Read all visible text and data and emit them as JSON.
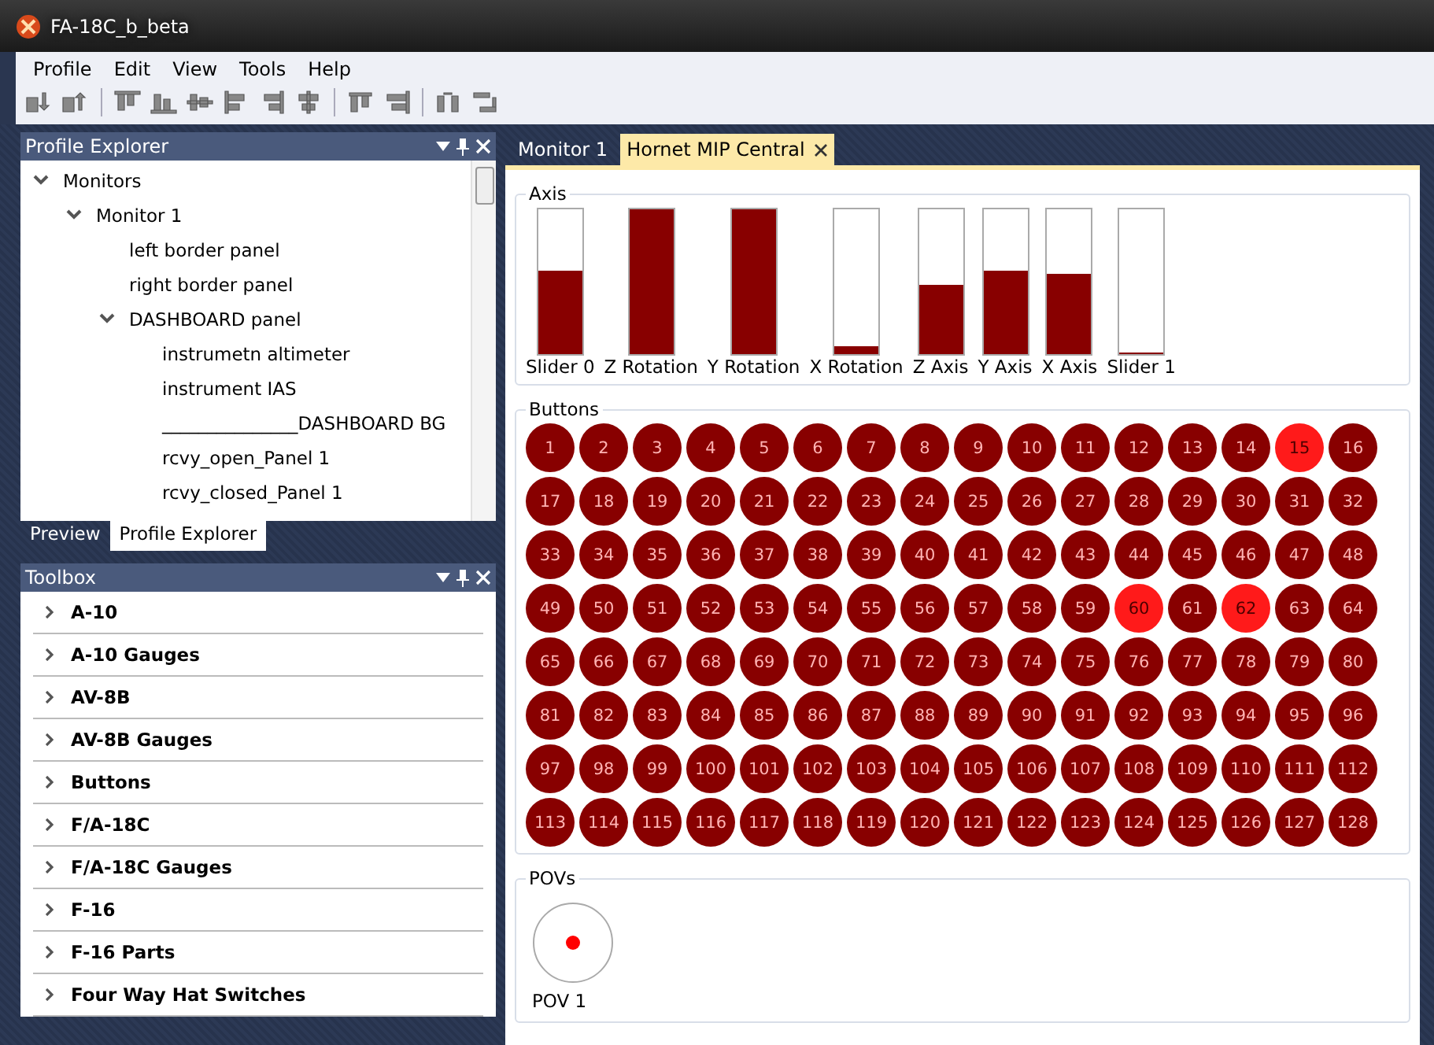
{
  "window": {
    "title": "FA-18C_b_beta"
  },
  "menu": [
    "Profile",
    "Edit",
    "View",
    "Tools",
    "Help"
  ],
  "profile_explorer": {
    "title": "Profile Explorer",
    "tree": [
      {
        "label": "Monitors",
        "expanded": true,
        "children": [
          {
            "label": "Monitor 1",
            "expanded": true,
            "children": [
              {
                "label": "left border panel"
              },
              {
                "label": "right border panel"
              },
              {
                "label": "DASHBOARD panel",
                "expanded": true,
                "children": [
                  {
                    "label": "instrumetn altimeter"
                  },
                  {
                    "label": "instrument IAS"
                  },
                  {
                    "label": "_______________DASHBOARD BG"
                  },
                  {
                    "label": "rcvy_open_Panel 1"
                  },
                  {
                    "label": "rcvy_closed_Panel 1"
                  }
                ]
              }
            ]
          }
        ]
      }
    ],
    "tabs": [
      {
        "label": "Preview",
        "selected": false
      },
      {
        "label": "Profile Explorer",
        "selected": true
      }
    ]
  },
  "toolbox": {
    "title": "Toolbox",
    "items": [
      "A-10",
      "A-10 Gauges",
      "AV-8B",
      "AV-8B Gauges",
      "Buttons",
      "F/A-18C",
      "F/A-18C Gauges",
      "F-16",
      "F-16 Parts",
      "Four Way Hat Switches"
    ]
  },
  "document_tabs": [
    {
      "label": "Monitor 1",
      "selected": false
    },
    {
      "label": "Hornet MIP Central",
      "selected": true,
      "closable": true
    }
  ],
  "axis": {
    "title": "Axis",
    "items": [
      {
        "name": "Slider 0",
        "level": 0.58
      },
      {
        "name": "Z Rotation",
        "level": 1
      },
      {
        "name": "Y Rotation",
        "level": 1
      },
      {
        "name": "X Rotation",
        "level": 0.05
      },
      {
        "name": "Z Axis",
        "level": 0.48
      },
      {
        "name": "Y Axis",
        "level": 0.58
      },
      {
        "name": "X Axis",
        "level": 0.55
      },
      {
        "name": "Slider 1",
        "level": 0
      }
    ]
  },
  "buttons": {
    "title": "Buttons",
    "items": [
      {
        "label": "1",
        "pressed": false
      },
      {
        "label": "2",
        "pressed": false
      },
      {
        "label": "3",
        "pressed": false
      },
      {
        "label": "4",
        "pressed": false
      },
      {
        "label": "5",
        "pressed": false
      },
      {
        "label": "6",
        "pressed": false
      },
      {
        "label": "7",
        "pressed": false
      },
      {
        "label": "8",
        "pressed": false
      },
      {
        "label": "9",
        "pressed": false
      },
      {
        "label": "10",
        "pressed": false
      },
      {
        "label": "11",
        "pressed": false
      },
      {
        "label": "12",
        "pressed": false
      },
      {
        "label": "13",
        "pressed": false
      },
      {
        "label": "14",
        "pressed": false
      },
      {
        "label": "15",
        "pressed": true
      },
      {
        "label": "16",
        "pressed": false
      },
      {
        "label": "17",
        "pressed": false
      },
      {
        "label": "18",
        "pressed": false
      },
      {
        "label": "19",
        "pressed": false
      },
      {
        "label": "20",
        "pressed": false
      },
      {
        "label": "21",
        "pressed": false
      },
      {
        "label": "22",
        "pressed": false
      },
      {
        "label": "23",
        "pressed": false
      },
      {
        "label": "24",
        "pressed": false
      },
      {
        "label": "25",
        "pressed": false
      },
      {
        "label": "26",
        "pressed": false
      },
      {
        "label": "27",
        "pressed": false
      },
      {
        "label": "28",
        "pressed": false
      },
      {
        "label": "29",
        "pressed": false
      },
      {
        "label": "30",
        "pressed": false
      },
      {
        "label": "31",
        "pressed": false
      },
      {
        "label": "32",
        "pressed": false
      },
      {
        "label": "33",
        "pressed": false
      },
      {
        "label": "34",
        "pressed": false
      },
      {
        "label": "35",
        "pressed": false
      },
      {
        "label": "36",
        "pressed": false
      },
      {
        "label": "37",
        "pressed": false
      },
      {
        "label": "38",
        "pressed": false
      },
      {
        "label": "39",
        "pressed": false
      },
      {
        "label": "40",
        "pressed": false
      },
      {
        "label": "41",
        "pressed": false
      },
      {
        "label": "42",
        "pressed": false
      },
      {
        "label": "43",
        "pressed": false
      },
      {
        "label": "44",
        "pressed": false
      },
      {
        "label": "45",
        "pressed": false
      },
      {
        "label": "46",
        "pressed": false
      },
      {
        "label": "47",
        "pressed": false
      },
      {
        "label": "48",
        "pressed": false
      },
      {
        "label": "49",
        "pressed": false
      },
      {
        "label": "50",
        "pressed": false
      },
      {
        "label": "51",
        "pressed": false
      },
      {
        "label": "52",
        "pressed": false
      },
      {
        "label": "53",
        "pressed": false
      },
      {
        "label": "54",
        "pressed": false
      },
      {
        "label": "55",
        "pressed": false
      },
      {
        "label": "56",
        "pressed": false
      },
      {
        "label": "57",
        "pressed": false
      },
      {
        "label": "58",
        "pressed": false
      },
      {
        "label": "59",
        "pressed": false
      },
      {
        "label": "60",
        "pressed": true
      },
      {
        "label": "61",
        "pressed": false
      },
      {
        "label": "62",
        "pressed": true
      },
      {
        "label": "63",
        "pressed": false
      },
      {
        "label": "64",
        "pressed": false
      },
      {
        "label": "65",
        "pressed": false
      },
      {
        "label": "66",
        "pressed": false
      },
      {
        "label": "67",
        "pressed": false
      },
      {
        "label": "68",
        "pressed": false
      },
      {
        "label": "69",
        "pressed": false
      },
      {
        "label": "70",
        "pressed": false
      },
      {
        "label": "71",
        "pressed": false
      },
      {
        "label": "72",
        "pressed": false
      },
      {
        "label": "73",
        "pressed": false
      },
      {
        "label": "74",
        "pressed": false
      },
      {
        "label": "75",
        "pressed": false
      },
      {
        "label": "76",
        "pressed": false
      },
      {
        "label": "77",
        "pressed": false
      },
      {
        "label": "78",
        "pressed": false
      },
      {
        "label": "79",
        "pressed": false
      },
      {
        "label": "80",
        "pressed": false
      },
      {
        "label": "81",
        "pressed": false
      },
      {
        "label": "82",
        "pressed": false
      },
      {
        "label": "83",
        "pressed": false
      },
      {
        "label": "84",
        "pressed": false
      },
      {
        "label": "85",
        "pressed": false
      },
      {
        "label": "86",
        "pressed": false
      },
      {
        "label": "87",
        "pressed": false
      },
      {
        "label": "88",
        "pressed": false
      },
      {
        "label": "89",
        "pressed": false
      },
      {
        "label": "90",
        "pressed": false
      },
      {
        "label": "91",
        "pressed": false
      },
      {
        "label": "92",
        "pressed": false
      },
      {
        "label": "93",
        "pressed": false
      },
      {
        "label": "94",
        "pressed": false
      },
      {
        "label": "95",
        "pressed": false
      },
      {
        "label": "96",
        "pressed": false
      },
      {
        "label": "97",
        "pressed": false
      },
      {
        "label": "98",
        "pressed": false
      },
      {
        "label": "99",
        "pressed": false
      },
      {
        "label": "100",
        "pressed": false
      },
      {
        "label": "101",
        "pressed": false
      },
      {
        "label": "102",
        "pressed": false
      },
      {
        "label": "103",
        "pressed": false
      },
      {
        "label": "104",
        "pressed": false
      },
      {
        "label": "105",
        "pressed": false
      },
      {
        "label": "106",
        "pressed": false
      },
      {
        "label": "107",
        "pressed": false
      },
      {
        "label": "108",
        "pressed": false
      },
      {
        "label": "109",
        "pressed": false
      },
      {
        "label": "110",
        "pressed": false
      },
      {
        "label": "111",
        "pressed": false
      },
      {
        "label": "112",
        "pressed": false
      },
      {
        "label": "113",
        "pressed": false
      },
      {
        "label": "114",
        "pressed": false
      },
      {
        "label": "115",
        "pressed": false
      },
      {
        "label": "116",
        "pressed": false
      },
      {
        "label": "117",
        "pressed": false
      },
      {
        "label": "118",
        "pressed": false
      },
      {
        "label": "119",
        "pressed": false
      },
      {
        "label": "120",
        "pressed": false
      },
      {
        "label": "121",
        "pressed": false
      },
      {
        "label": "122",
        "pressed": false
      },
      {
        "label": "123",
        "pressed": false
      },
      {
        "label": "124",
        "pressed": false
      },
      {
        "label": "125",
        "pressed": false
      },
      {
        "label": "126",
        "pressed": false
      },
      {
        "label": "127",
        "pressed": false
      },
      {
        "label": "128",
        "pressed": false
      }
    ]
  },
  "povs": {
    "title": "POVs",
    "items": [
      {
        "name": "POV 1"
      }
    ]
  }
}
